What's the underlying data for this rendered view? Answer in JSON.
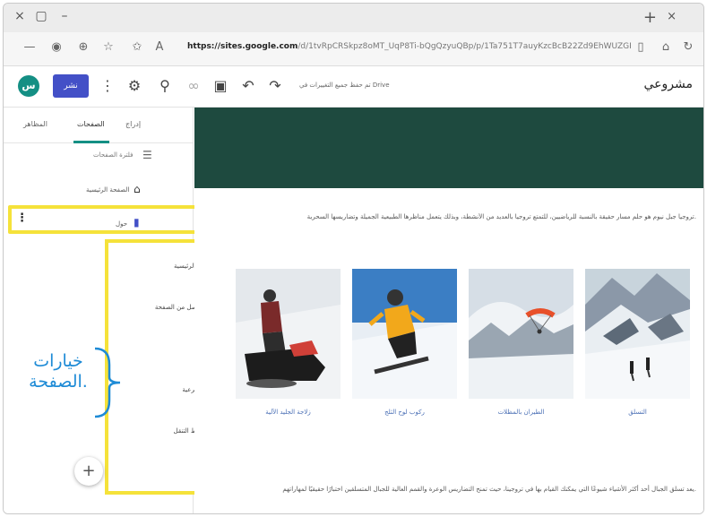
{
  "browser": {
    "window_controls": [
      "×",
      "▢",
      "–"
    ],
    "newtab": "+",
    "tab_close": "×",
    "url_domain": "https://sites.google.com",
    "url_rest": "/d/1tvRpCRSkpz8oMT_UqP8Ti-bQgQzyuQBp/p/1Ta751T7auyKzcBcB22Zd9EhWUZGRMQd/edit"
  },
  "toolbar": {
    "avatar_letter": "س",
    "publish_label": "نشر",
    "draft_note": "تم حفظ جميع التغييرات في Drive",
    "site_title": "مشروعي"
  },
  "sidebar": {
    "tabs": [
      "إدراج",
      "الصفحات",
      "المظاهر"
    ],
    "filter_label": "فلترة الصفحات",
    "home_label": "الصفحة الرئيسية",
    "page_label": "حول",
    "fab_label": "+"
  },
  "menu": {
    "items": [
      "جعلها صفحتك الرئيسية",
      "نسخة طبق الأصل من الصفحة",
      "الخصائص",
      "إضافة صفحة فرعية",
      "إخفاء من شريط التنقل",
      "حذف"
    ]
  },
  "annotation": {
    "line1": "خيارات",
    "line2": "الصفحة."
  },
  "content": {
    "intro": "تروجيا جبل نيوم هو حلم مسار حقيقة بالنسبة للرياضيين، للتمتع تروجيا بالعديد من الأنشطة، وبذلك يتعمل مناظرها الطبيعية الجميلة وتضاريسها السحرية.",
    "captions": [
      "التسلق",
      "الطيران بالمظلات",
      "ركوب لوح الثلج",
      "زلاجة الجليد الآلية"
    ],
    "bottom_text": "يعد تسلق الجبال أحد أكثر الأشياء شيوعًا التي يمكنك القيام بها في تروجينا، حيث تمنح التضاريس الوعرة والقمم العالية للجبال المتسلقين اختبارًا حقيقيًا لمهاراتهم."
  },
  "colors": {
    "accent": "#148f84",
    "publish": "#4350c7",
    "highlight": "#f5e23a",
    "annotation": "#1e8bd6",
    "hero": "#1e4a3f"
  }
}
